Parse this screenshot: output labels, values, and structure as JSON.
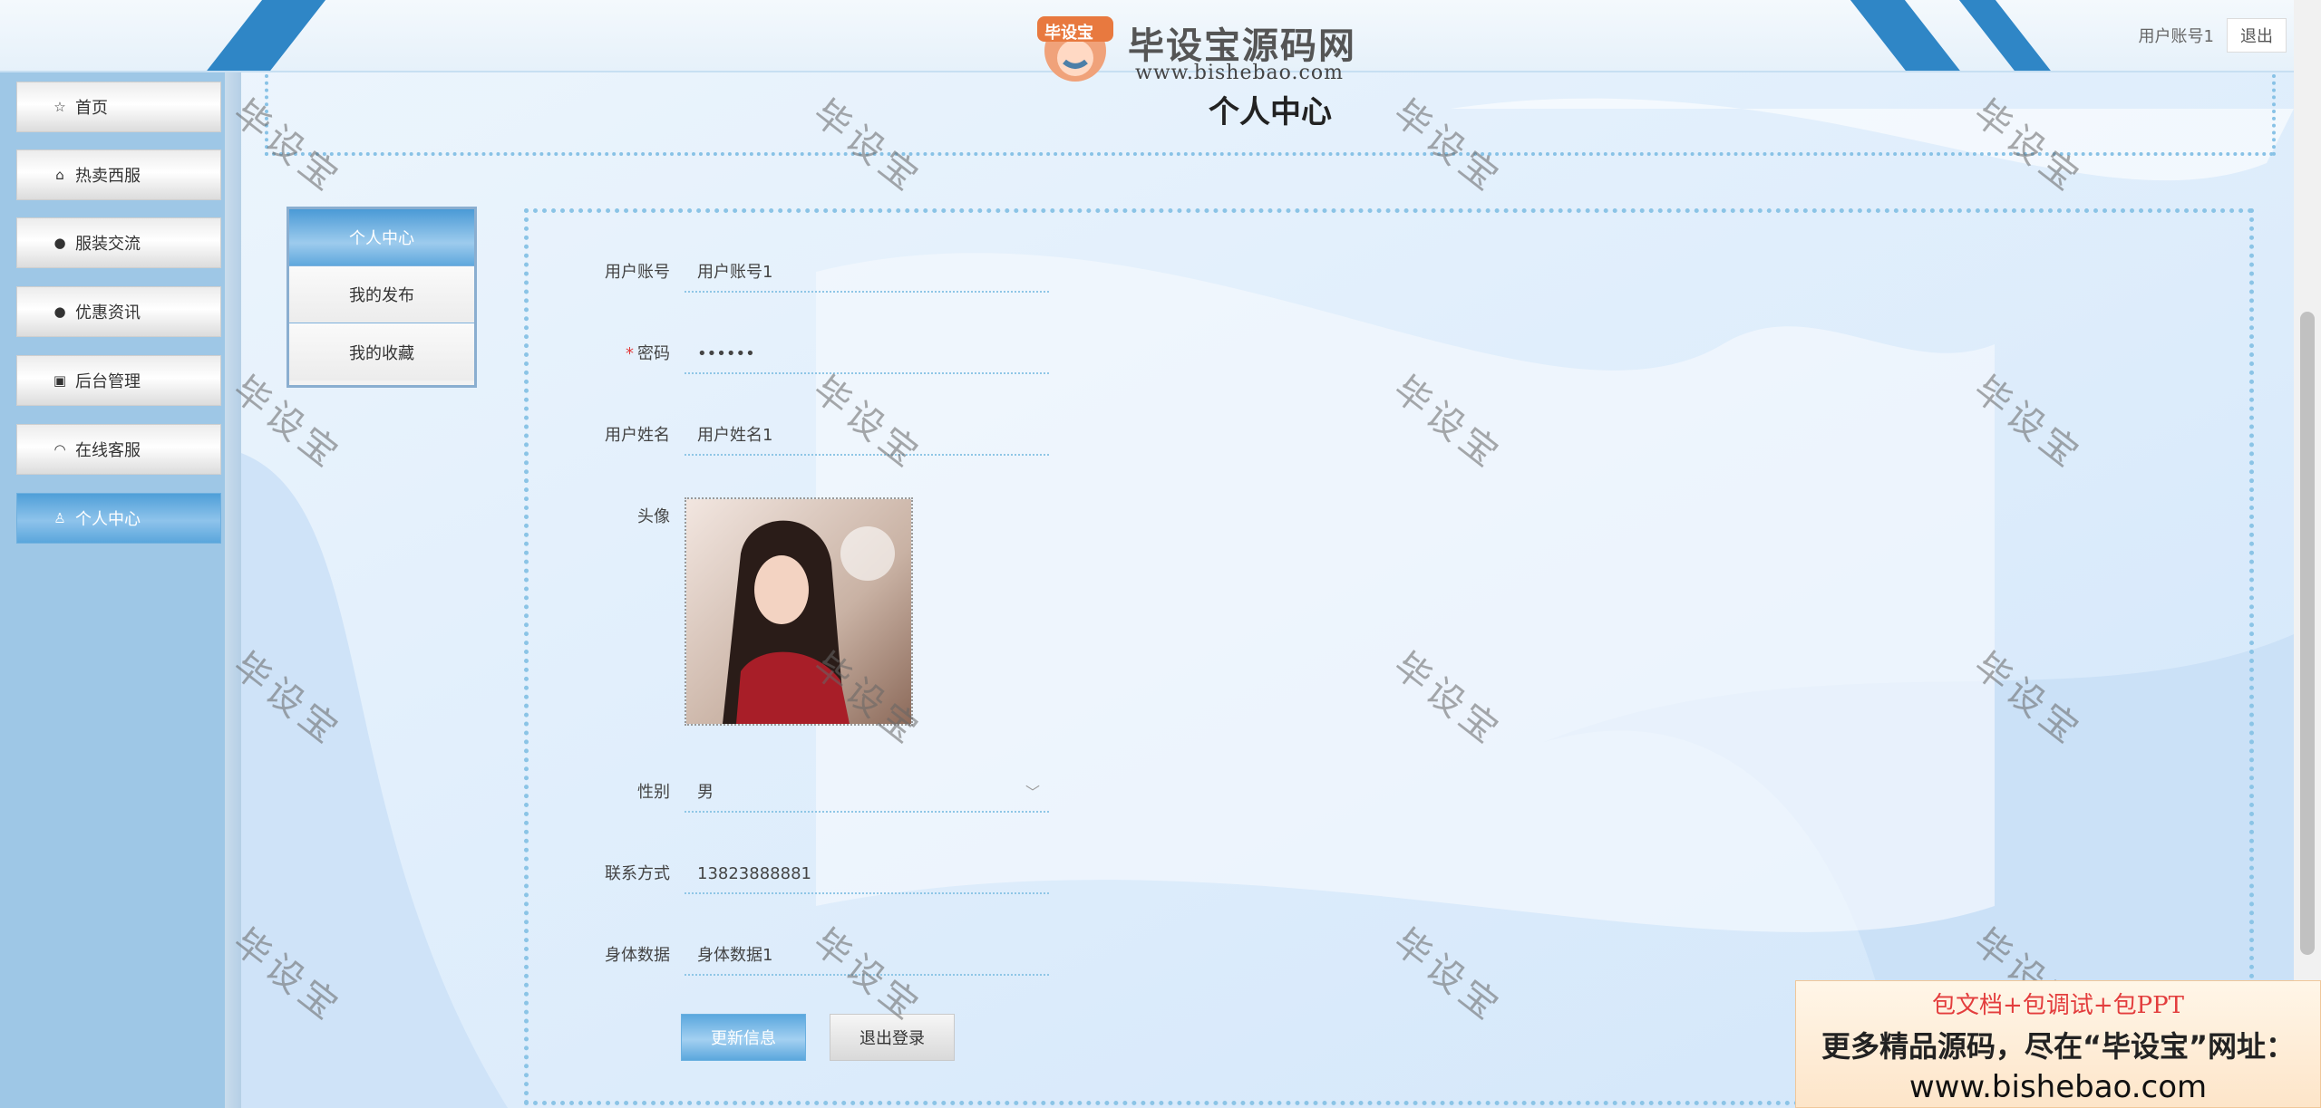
{
  "header": {
    "user_label": "用户账号1",
    "logout_label": "退出"
  },
  "logo": {
    "badge_text": "毕设宝",
    "brand": "毕设宝源码网",
    "url": "www.bishebao.com"
  },
  "sidebar": {
    "items": [
      {
        "label": "首页",
        "icon": "star-icon",
        "glyph": "☆"
      },
      {
        "label": "热卖西服",
        "icon": "bag-icon",
        "glyph": "⌂"
      },
      {
        "label": "服装交流",
        "icon": "alert-icon",
        "glyph": "●"
      },
      {
        "label": "优惠资讯",
        "icon": "question-icon",
        "glyph": "●"
      },
      {
        "label": "后台管理",
        "icon": "box-icon",
        "glyph": "▣"
      },
      {
        "label": "在线客服",
        "icon": "headset-icon",
        "glyph": "◠"
      },
      {
        "label": "个人中心",
        "icon": "user-icon",
        "glyph": "♙"
      }
    ]
  },
  "page": {
    "title": "个人中心"
  },
  "tabs": [
    {
      "label": "个人中心"
    },
    {
      "label": "我的发布"
    },
    {
      "label": "我的收藏"
    }
  ],
  "form": {
    "account": {
      "label": "用户账号",
      "value": "用户账号1"
    },
    "password": {
      "label": "密码",
      "required_mark": "*",
      "value": "••••••"
    },
    "name": {
      "label": "用户姓名",
      "value": "用户姓名1"
    },
    "avatar": {
      "label": "头像"
    },
    "gender": {
      "label": "性别",
      "value": "男"
    },
    "phone": {
      "label": "联系方式",
      "value": "13823888881"
    },
    "body": {
      "label": "身体数据",
      "value": "身体数据1"
    },
    "update_button": "更新信息",
    "logout_button": "退出登录"
  },
  "watermark": "毕设宝",
  "promo": {
    "line1": "包文档+包调试+包PPT",
    "line2": "更多精品源码，尽在“毕设宝”网址：",
    "line3": "www.bishebao.com"
  },
  "colors": {
    "accent": "#2f86c6",
    "sidebar": "#9ec7e6",
    "dotted_border": "#8bc4e6"
  }
}
